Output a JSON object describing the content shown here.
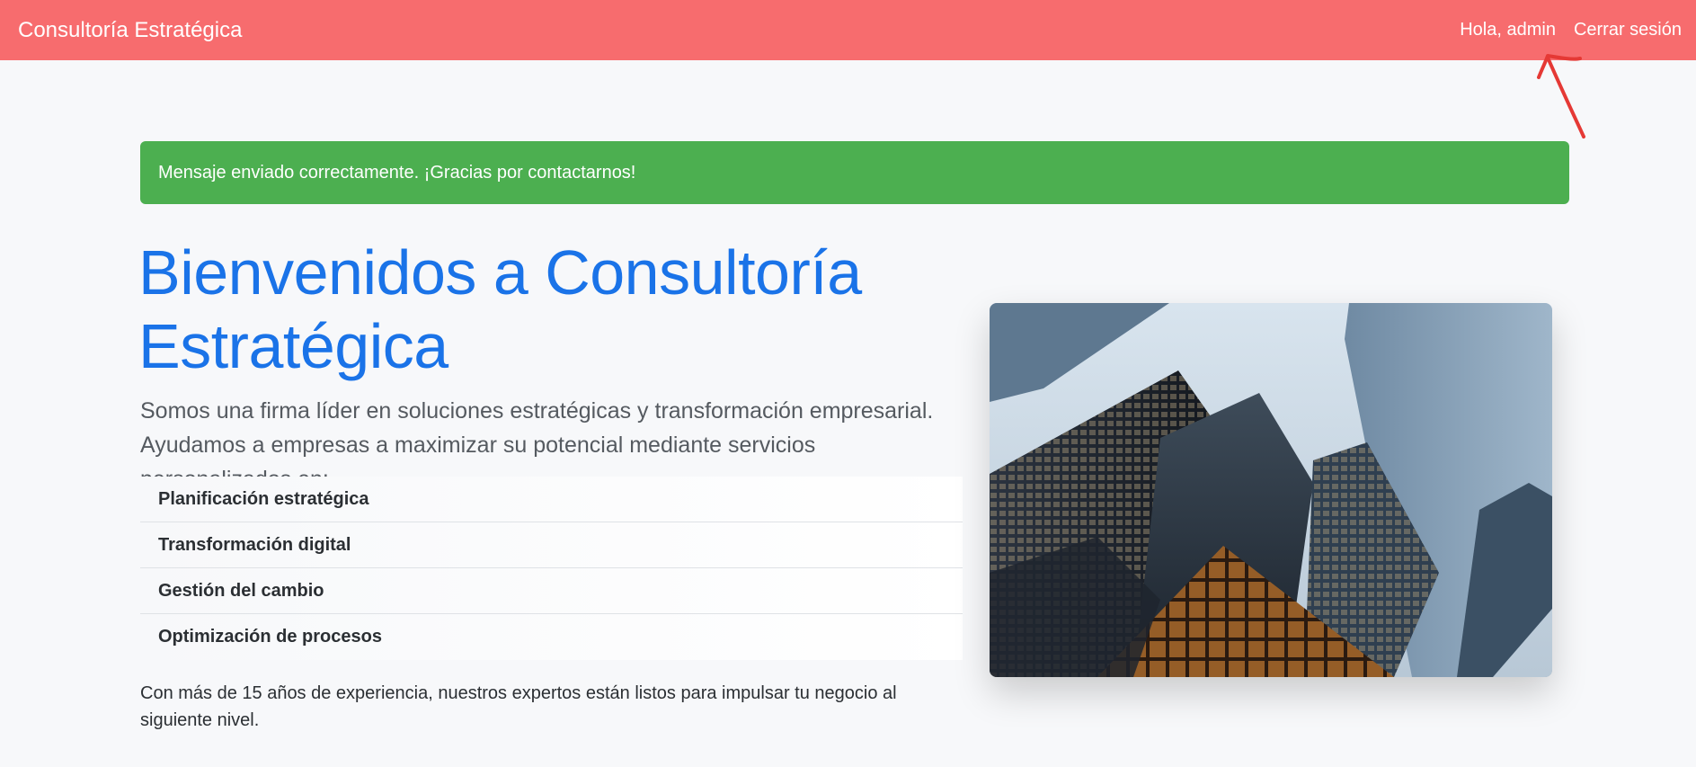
{
  "navbar": {
    "brand": "Consultoría Estratégica",
    "greeting": "Hola, admin",
    "logout": "Cerrar sesión",
    "color": "#f76c6e"
  },
  "alert": {
    "message": "Mensaje enviado correctamente. ¡Gracias por contactarnos!",
    "color": "#4caf50"
  },
  "hero": {
    "title_line1": "Bienvenidos a Consultoría",
    "title_line2": "Estratégica",
    "lead_line1": "Somos una firma líder en soluciones estratégicas y transformación empresarial.",
    "lead_line2": "Ayudamos a empresas a maximizar su potencial mediante servicios personalizados en:",
    "services": [
      "Planificación estratégica",
      "Transformación digital",
      "Gestión del cambio",
      "Optimización de procesos"
    ],
    "footer": "Con más de 15 años de experiencia, nuestros expertos están listos para impulsar tu negocio al siguiente nivel.",
    "title_color": "#1a73e8"
  },
  "image": {
    "subject": "skyscrapers-photo"
  },
  "annotation": {
    "icon": "red-arrow-annotation",
    "color": "#e53935"
  }
}
